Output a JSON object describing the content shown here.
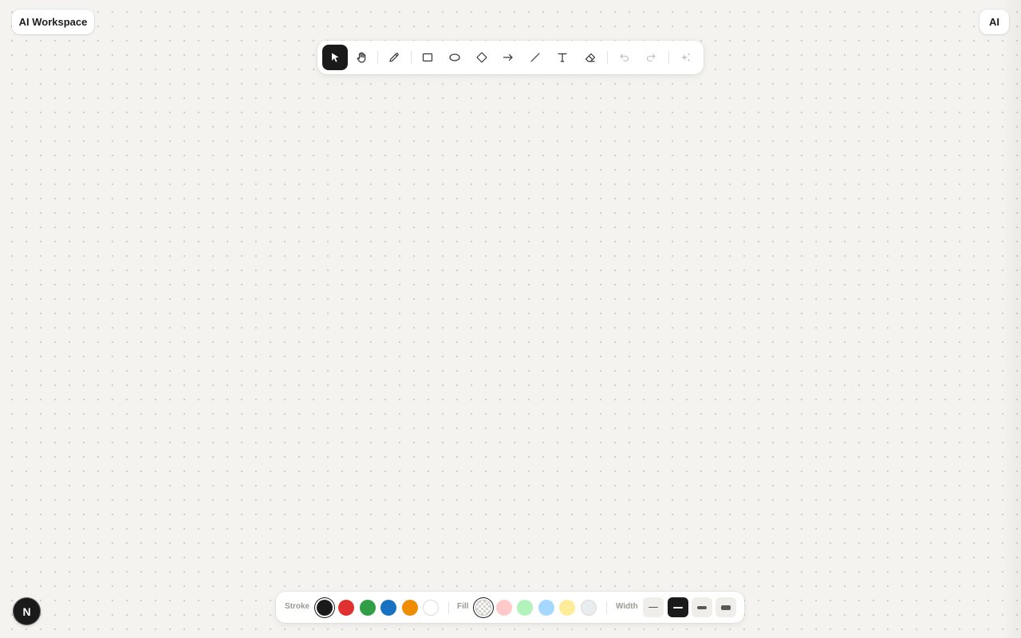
{
  "workspace": {
    "title": "AI Workspace",
    "ai_button_label": "AI"
  },
  "toolbar": {
    "tools": [
      {
        "name": "select",
        "icon": "cursor-arrow-icon",
        "active": true
      },
      {
        "name": "hand",
        "icon": "hand-icon",
        "active": false
      },
      {
        "name": "pencil",
        "icon": "pencil-icon",
        "active": false
      },
      {
        "name": "rectangle",
        "icon": "rectangle-icon",
        "active": false
      },
      {
        "name": "ellipse",
        "icon": "ellipse-icon",
        "active": false
      },
      {
        "name": "diamond",
        "icon": "diamond-icon",
        "active": false
      },
      {
        "name": "arrow",
        "icon": "arrow-right-icon",
        "active": false
      },
      {
        "name": "line",
        "icon": "line-icon",
        "active": false
      },
      {
        "name": "text",
        "icon": "text-icon",
        "active": false
      },
      {
        "name": "eraser",
        "icon": "eraser-icon",
        "active": false
      },
      {
        "name": "undo",
        "icon": "undo-icon",
        "disabled": true
      },
      {
        "name": "redo",
        "icon": "redo-icon",
        "disabled": true
      },
      {
        "name": "ai-magic",
        "icon": "sparkles-icon",
        "disabled": true
      }
    ]
  },
  "style_bar": {
    "stroke_label": "Stroke",
    "fill_label": "Fill",
    "width_label": "Width",
    "stroke_colors": [
      "#1a1a1a",
      "#e03131",
      "#2f9e44",
      "#1971c2",
      "#f08c00",
      "#ffffff"
    ],
    "stroke_selected": "#1a1a1a",
    "fill_colors": [
      "transparent",
      "#ffc9c9",
      "#b2f2bb",
      "#a5d8ff",
      "#ffec99",
      "#e9ecef"
    ],
    "fill_selected": "transparent",
    "widths": [
      "thin",
      "medium",
      "bold",
      "extra-bold"
    ],
    "width_selected": "medium"
  },
  "user_badge": {
    "initial": "N"
  }
}
